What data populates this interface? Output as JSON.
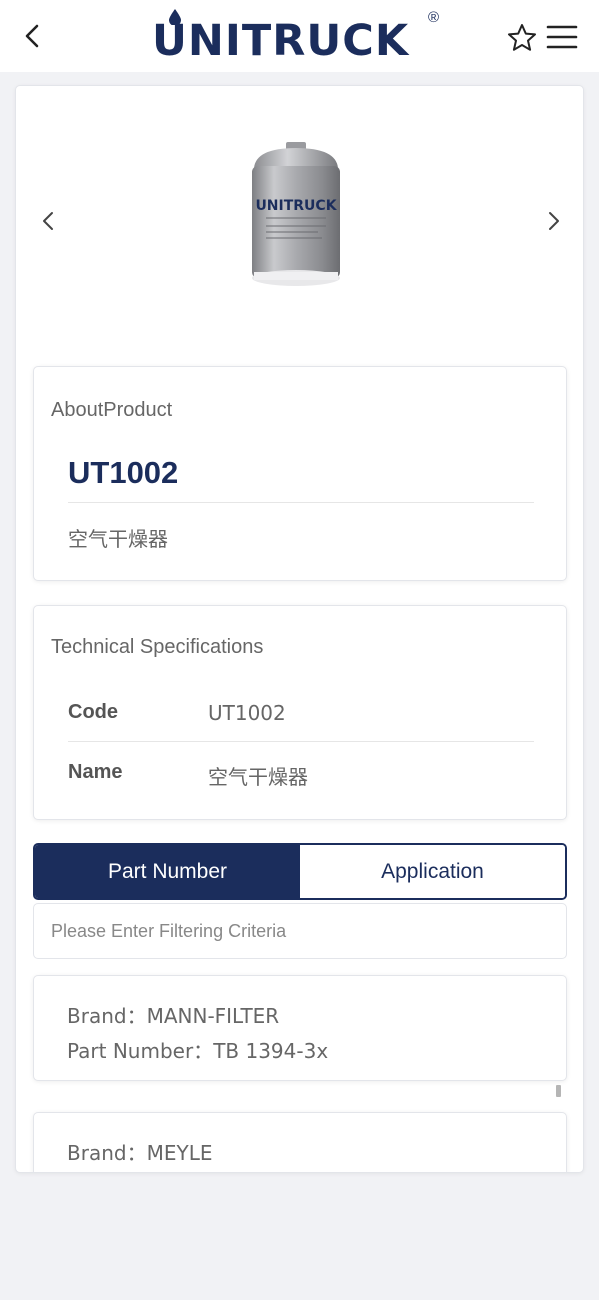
{
  "header": {
    "logo_text": "UNITRUCK",
    "logo_mark": "®",
    "back_icon": "chevron-left-icon",
    "favorite_icon": "star-outline-icon",
    "menu_icon": "hamburger-menu-icon",
    "brand_color": "#1b2d5c"
  },
  "gallery": {
    "prev_icon": "chevron-left-icon",
    "next_icon": "chevron-right-icon",
    "image_label": "UNITRUCK"
  },
  "about": {
    "title": "AboutProduct",
    "code": "UT1002",
    "name": "空气干燥器"
  },
  "specs": {
    "title": "Technical Specifications",
    "rows": [
      {
        "label": "Code",
        "value": "UT1002"
      },
      {
        "label": "Name",
        "value": "空气干燥器"
      }
    ]
  },
  "tabs": {
    "items": [
      {
        "label": "Part Number",
        "active": true
      },
      {
        "label": "Application",
        "active": false
      }
    ]
  },
  "filter": {
    "placeholder": "Please Enter Filtering Criteria",
    "value": ""
  },
  "results": [
    {
      "brand_label": "Brand：",
      "brand": "MANN-FILTER",
      "part_label": "Part Number：",
      "part_number": "TB 1394-3x"
    },
    {
      "brand_label": "Brand：",
      "brand": "MEYLE"
    }
  ]
}
